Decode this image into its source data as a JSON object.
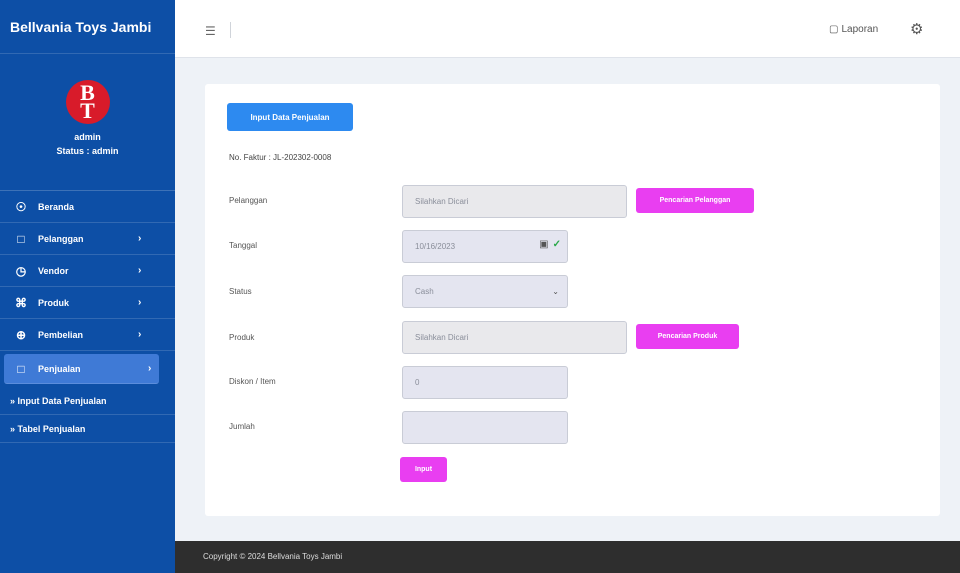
{
  "app": {
    "brand": "Bellvania Toys Jambi"
  },
  "sidebar": {
    "logo": {
      "letter_top": "B",
      "letter_bottom": "T"
    },
    "user": {
      "name": "admin",
      "status": "Status : admin"
    },
    "menu": [
      {
        "label": "Beranda",
        "icon": "home-icon",
        "has_arrow": false
      },
      {
        "label": "Pelanggan",
        "icon": "file-icon",
        "has_arrow": true
      },
      {
        "label": "Vendor",
        "icon": "clock-icon",
        "has_arrow": true
      },
      {
        "label": "Produk",
        "icon": "command-icon",
        "has_arrow": true
      },
      {
        "label": "Pembelian",
        "icon": "globe-icon",
        "has_arrow": true
      },
      {
        "label": "Penjualan",
        "icon": "square-icon",
        "has_arrow": true,
        "active": true
      }
    ],
    "submenu": [
      "» Input Data Penjualan",
      "» Tabel Penjualan"
    ]
  },
  "topbar": {
    "laporan_label": "Laporan"
  },
  "form": {
    "header_button": "Input Data Penjualan",
    "no_faktur": "No. Faktur : JL-202302-0008",
    "pelanggan": {
      "label": "Pelanggan",
      "placeholder": "Silahkan Dicari",
      "button": "Pencarian Pelanggan"
    },
    "tanggal": {
      "label": "Tanggal",
      "value": "10/16/2023"
    },
    "status": {
      "label": "Status",
      "value": "Cash"
    },
    "produk": {
      "label": "Produk",
      "placeholder": "Silahkan Dicari",
      "button": "Pencarian Produk"
    },
    "diskon": {
      "label": "Diskon / Item",
      "value": "0"
    },
    "jumlah": {
      "label": "Jumlah",
      "value": ""
    },
    "submit_button": "Input"
  },
  "footer": {
    "text": "Copyright © 2024 Bellvania Toys Jambi"
  },
  "colors": {
    "sidebar": "#0d4fa6",
    "primary": "#2d8af0",
    "accent": "#e93ef1",
    "footer": "#2e2e2e"
  }
}
